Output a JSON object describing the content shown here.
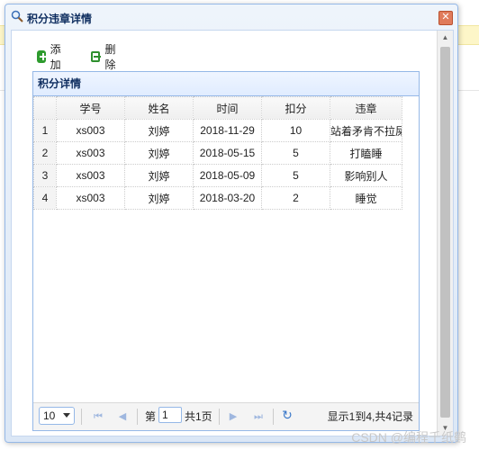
{
  "dialog": {
    "title": "积分违章详情",
    "close_glyph": "✕"
  },
  "toolbar": {
    "add_label": "添加",
    "delete_label": "删除"
  },
  "grid": {
    "title": "积分详情",
    "columns": [
      "学号",
      "姓名",
      "时间",
      "扣分",
      "违章"
    ],
    "rows": [
      {
        "rownum": "1",
        "student_id": "xs003",
        "name": "刘婷",
        "time": "2018-11-29",
        "deduction": "10",
        "violation": "站着矛肯不拉屎"
      },
      {
        "rownum": "2",
        "student_id": "xs003",
        "name": "刘婷",
        "time": "2018-05-15",
        "deduction": "5",
        "violation": "打瞌睡"
      },
      {
        "rownum": "3",
        "student_id": "xs003",
        "name": "刘婷",
        "time": "2018-05-09",
        "deduction": "5",
        "violation": "影响别人"
      },
      {
        "rownum": "4",
        "student_id": "xs003",
        "name": "刘婷",
        "time": "2018-03-20",
        "deduction": "2",
        "violation": "睡觉"
      }
    ]
  },
  "pager": {
    "page_size": "10",
    "page_prefix": "第",
    "page_value": "1",
    "page_total": "共1页",
    "info": "显示1到4,共4记录"
  },
  "watermark": "CSDN @编程千纸鹤",
  "colors": {
    "border_blue": "#95b8e7",
    "add_green": "#2e9b2e",
    "close_red": "#e07b5b"
  }
}
